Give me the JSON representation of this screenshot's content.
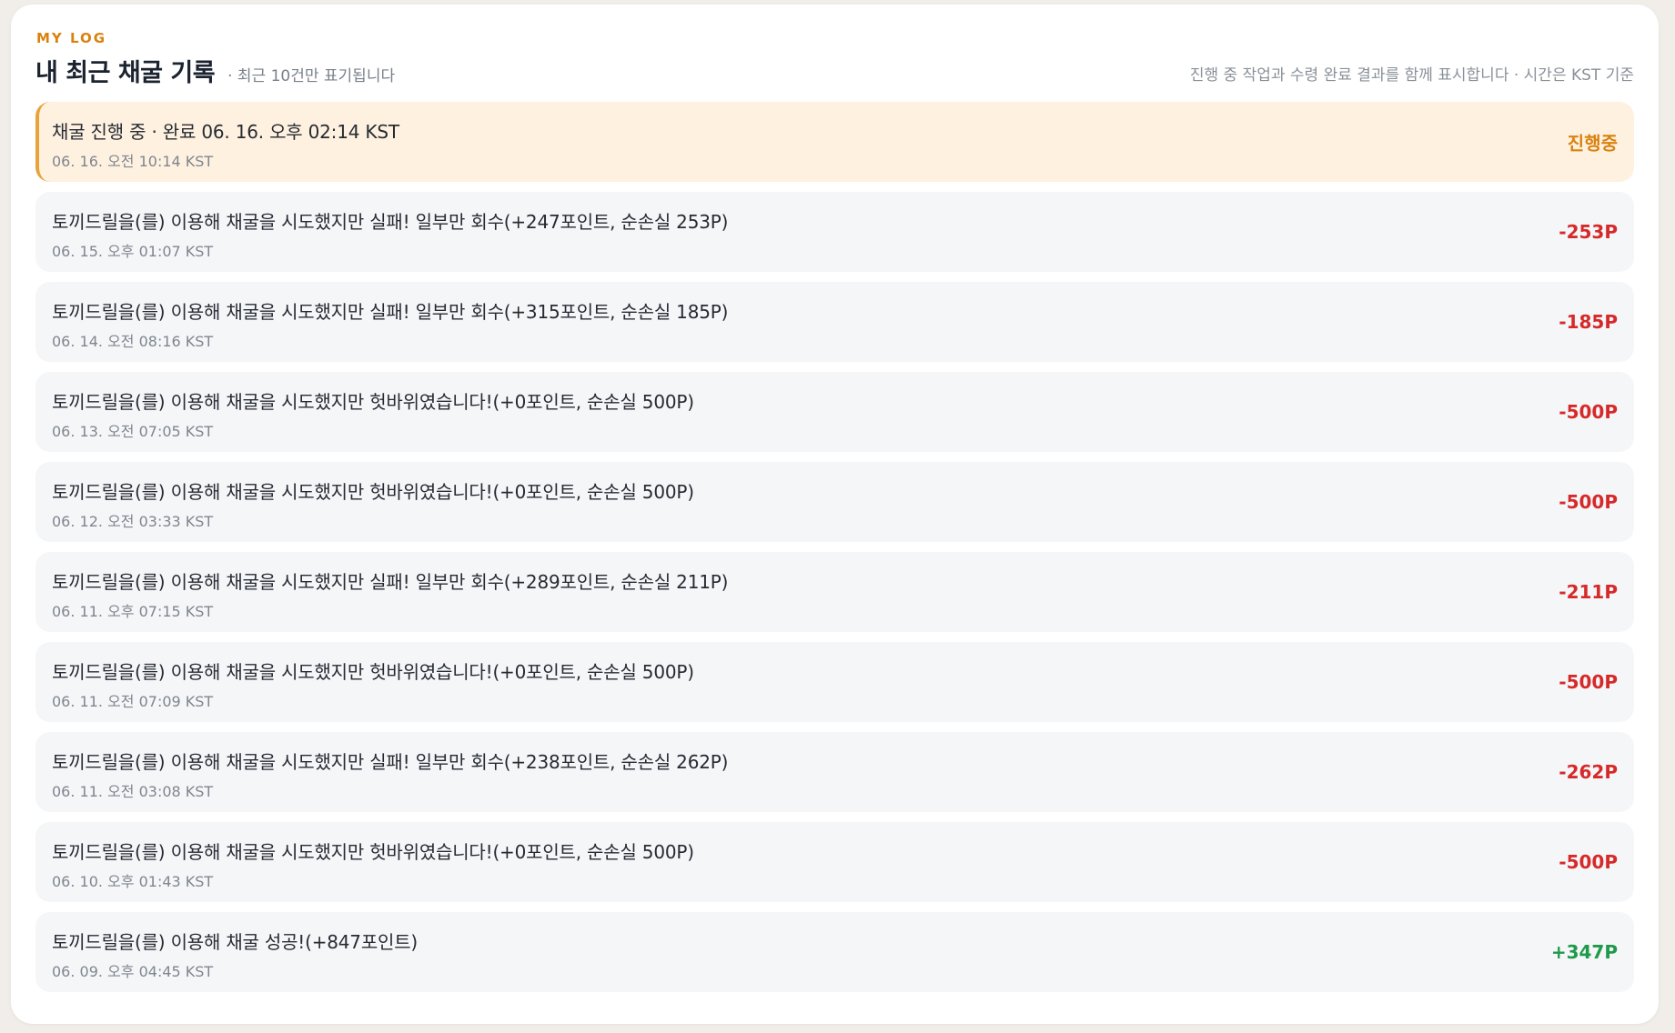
{
  "header": {
    "eyebrow": "MY LOG",
    "title": "내 최근 채굴 기록",
    "note": "· 최근 10건만 표기됩니다",
    "right_note": "진행 중 작업과 수령 완료 결과를 함께 표시합니다 · 시간은 KST 기준"
  },
  "colors": {
    "accent": "#d9820f",
    "loss": "#d62a2a",
    "gain": "#1f9a4a",
    "active_bg": "#fff1e0"
  },
  "rows": [
    {
      "text": "채굴 진행 중 · 완료 06. 16. 오후 02:14 KST",
      "time": "06. 16. 오전 10:14 KST",
      "amount": "진행중",
      "status": "progress"
    },
    {
      "text": "토끼드릴을(를) 이용해 채굴을 시도했지만 실패! 일부만 회수(+247포인트, 순손실 253P)",
      "time": "06. 15. 오후 01:07 KST",
      "amount": "-253P",
      "status": "loss"
    },
    {
      "text": "토끼드릴을(를) 이용해 채굴을 시도했지만 실패! 일부만 회수(+315포인트, 순손실 185P)",
      "time": "06. 14. 오전 08:16 KST",
      "amount": "-185P",
      "status": "loss"
    },
    {
      "text": "토끼드릴을(를) 이용해 채굴을 시도했지만 헛바위였습니다!(+0포인트, 순손실 500P)",
      "time": "06. 13. 오전 07:05 KST",
      "amount": "-500P",
      "status": "loss"
    },
    {
      "text": "토끼드릴을(를) 이용해 채굴을 시도했지만 헛바위였습니다!(+0포인트, 순손실 500P)",
      "time": "06. 12. 오전 03:33 KST",
      "amount": "-500P",
      "status": "loss"
    },
    {
      "text": "토끼드릴을(를) 이용해 채굴을 시도했지만 실패! 일부만 회수(+289포인트, 순손실 211P)",
      "time": "06. 11. 오후 07:15 KST",
      "amount": "-211P",
      "status": "loss"
    },
    {
      "text": "토끼드릴을(를) 이용해 채굴을 시도했지만 헛바위였습니다!(+0포인트, 순손실 500P)",
      "time": "06. 11. 오전 07:09 KST",
      "amount": "-500P",
      "status": "loss"
    },
    {
      "text": "토끼드릴을(를) 이용해 채굴을 시도했지만 실패! 일부만 회수(+238포인트, 순손실 262P)",
      "time": "06. 11. 오전 03:08 KST",
      "amount": "-262P",
      "status": "loss"
    },
    {
      "text": "토끼드릴을(를) 이용해 채굴을 시도했지만 헛바위였습니다!(+0포인트, 순손실 500P)",
      "time": "06. 10. 오후 01:43 KST",
      "amount": "-500P",
      "status": "loss"
    },
    {
      "text": "토끼드릴을(를) 이용해 채굴 성공!(+847포인트)",
      "time": "06. 09. 오후 04:45 KST",
      "amount": "+347P",
      "status": "gain"
    }
  ]
}
